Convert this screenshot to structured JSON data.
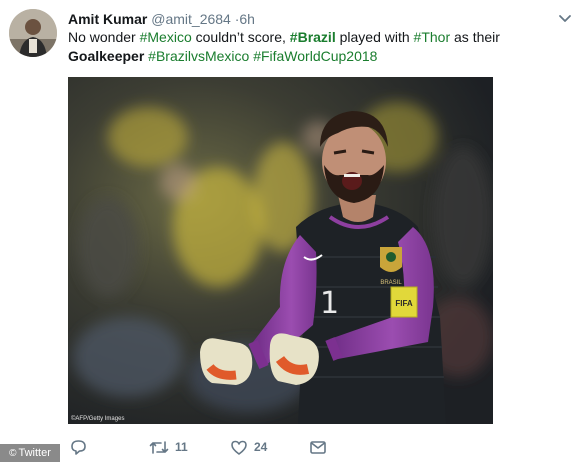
{
  "tweet": {
    "name": "Amit Kumar",
    "handle": "@amit_2684",
    "time": "·6h",
    "text_parts": {
      "t1": "No wonder ",
      "h1": "#Mexico",
      "t2": " couldn’t score, ",
      "h2": "#Brazil",
      "t3": " played with ",
      "h3": "#Thor",
      "t4": " as their",
      "t5": "Goalkeeper",
      "h4": "#BrazilvsMexico",
      "h5": "#FifaWorldCup2018"
    },
    "image_credit": "©AFP/Getty Images",
    "media_description": "Brazil goalkeeper in dark jersey with purple sleeves celebrating with clenched fists",
    "jersey_number": "1",
    "badge_text": "BRASIL",
    "fifa_patch": "FIFA"
  },
  "actions": {
    "reply_count": "",
    "retweet_count": "11",
    "like_count": "24"
  },
  "watermark": {
    "symbol": "©",
    "label": "Twitter"
  },
  "colors": {
    "hashtag": "#1a7d2e",
    "muted": "#657786",
    "sleeve": "#8e3fa0",
    "jersey": "#1e2226"
  },
  "icons": [
    "avatar",
    "chevron-down-icon",
    "reply-icon",
    "retweet-icon",
    "heart-icon",
    "dm-icon"
  ]
}
